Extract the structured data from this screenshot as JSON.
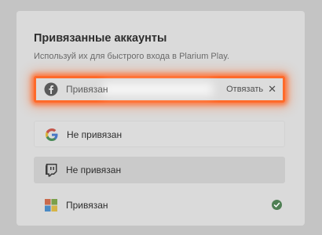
{
  "header": {
    "title": "Привязанные аккаунты",
    "subtitle": "Используй их для быстрого входа в Plarium Play."
  },
  "accounts": [
    {
      "provider_icon": "facebook-icon",
      "status": "Привязан",
      "action_label": "Отвязать",
      "action_icon": "close-icon"
    },
    {
      "provider_icon": "google-icon",
      "status": "Не привязан"
    },
    {
      "provider_icon": "twitch-icon",
      "status": "Не привязан"
    },
    {
      "provider_icon": "microsoft-icon",
      "status": "Привязан",
      "status_icon": "checkmark-icon"
    }
  ],
  "colors": {
    "highlight": "#ff6a2a",
    "success": "#4f7f54",
    "facebook": "#5a5a5a",
    "google_red": "#c4564a",
    "google_yellow": "#d8b23c",
    "google_green": "#4a8a58",
    "google_blue": "#4a78c4",
    "ms_red": "#c96a4c",
    "ms_green": "#7aa04a",
    "ms_blue": "#4a8ac4",
    "ms_yellow": "#d6b446"
  }
}
